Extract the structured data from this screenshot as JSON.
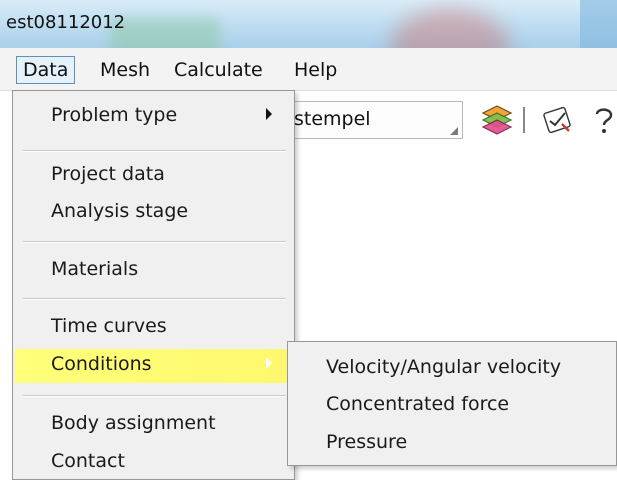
{
  "window": {
    "title": "est08112012"
  },
  "menubar": {
    "items": [
      {
        "label": "Data",
        "active": true
      },
      {
        "label": "Mesh"
      },
      {
        "label": "Calculate"
      },
      {
        "label": "Help"
      }
    ]
  },
  "toolbar": {
    "combo_value": "stempel",
    "icons": [
      "layers-icon",
      "checklist-icon",
      "help-icon"
    ]
  },
  "data_menu": {
    "items": [
      {
        "label": "Problem type",
        "submenu": true
      },
      {
        "label": "Project data"
      },
      {
        "label": "Analysis stage"
      },
      {
        "label": "Materials"
      },
      {
        "label": "Time curves"
      },
      {
        "label": "Conditions",
        "submenu": true,
        "highlighted": true
      },
      {
        "label": "Body assignment"
      },
      {
        "label": "Contact"
      }
    ]
  },
  "conditions_submenu": {
    "items": [
      {
        "label": "Velocity/Angular velocity"
      },
      {
        "label": "Concentrated force"
      },
      {
        "label": "Pressure"
      }
    ]
  },
  "colors": {
    "highlight": "#ffff7a",
    "menu_bg": "#f0f0f0",
    "active_menu_border": "#5f8fbf"
  }
}
